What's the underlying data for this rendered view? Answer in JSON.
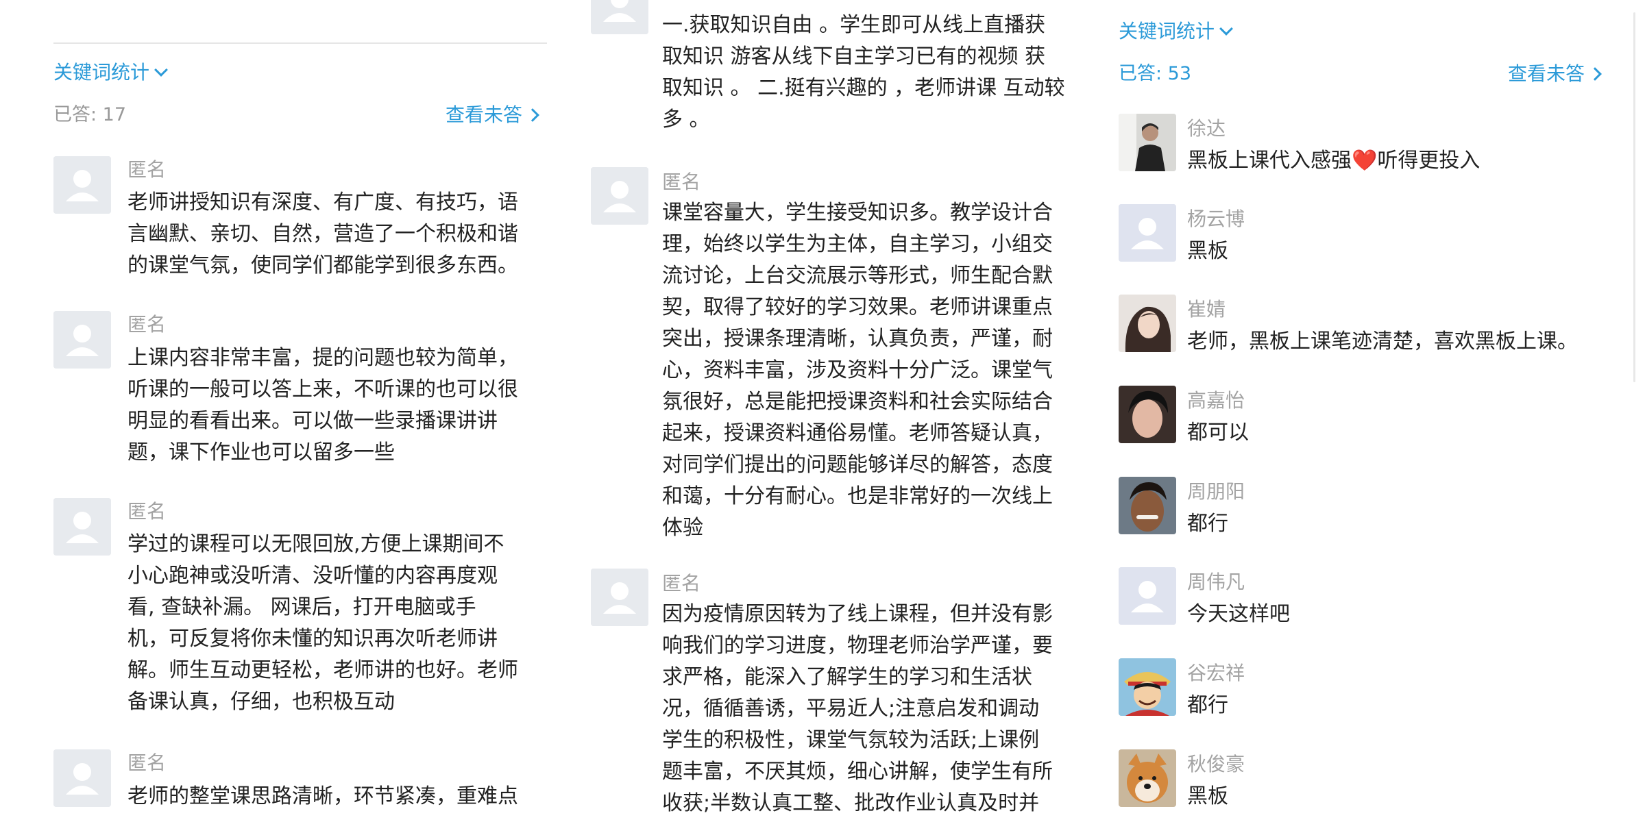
{
  "panels": {
    "left": {
      "keyword_toggle": "关键词统计",
      "answered": "已答: 17",
      "view_unanswered": "查看未答",
      "entries": [
        {
          "name": "匿名",
          "text": "老师讲授知识有深度、有广度、有技巧，语\n言幽默、亲切、自然，营造了一个积极和谐\n的课堂气氛，使同学们都能学到很多东西。"
        },
        {
          "name": "匿名",
          "text": "上课内容非常丰富，提的问题也较为简单，\n听课的一般可以答上来，不听课的也可以很\n明显的看看出来。可以做一些录播课讲讲\n题，课下作业也可以留多一些"
        },
        {
          "name": "匿名",
          "text": "学过的课程可以无限回放,方便上课期间不\n小心跑神或没听清、没听懂的内容再度观\n看, 查缺补漏。  网课后，打开电脑或手\n机，可反复将你未懂的知识再次听老师讲\n解。师生互动更轻松，老师讲的也好。老师\n备课认真，仔细，也积极互动"
        },
        {
          "name": "匿名",
          "text": "老师的整堂课思路清晰，环节紧凑，重难点"
        }
      ]
    },
    "middle": {
      "entries": [
        {
          "name": "",
          "text": "一.获取知识自由 。学生即可从线上直播获\n取知识 游客从线下自主学习已有的视频 获\n取知识 。 二.挺有兴趣的 ，老师讲课 互动较\n多 。"
        },
        {
          "name": "匿名",
          "text": "课堂容量大，学生接受知识多。教学设计合\n理，始终以学生为主体，自主学习，小组交\n流讨论，上台交流展示等形式，师生配合默\n契，取得了较好的学习效果。老师讲课重点\n突出，授课条理清晰，认真负责，严谨，耐\n心，资料丰富，涉及资料十分广泛。课堂气\n氛很好，总是能把授课资料和社会实际结合\n起来，授课资料通俗易懂。老师答疑认真，\n对同学们提出的问题能够详尽的解答，态度\n和蔼，十分有耐心。也是非常好的一次线上\n体验"
        },
        {
          "name": "匿名",
          "text": "因为疫情原因转为了线上课程，但并没有影\n响我们的学习进度，物理老师治学严谨，要\n求严格，能深入了解学生的学习和生活状\n况，循循善诱，平易近人;注意启发和调动\n学生的积极性，课堂气氛较为活跃;上课例\n题丰富，不厌其烦，细心讲解，使学生有所\n收获;半数认真工整、批改作业认真及时并"
        }
      ]
    },
    "right": {
      "keyword_toggle": "关键词统计",
      "answered": "已答: 53",
      "view_unanswered": "查看未答",
      "entries": [
        {
          "name": "徐达",
          "text": "黑板上课代入感强❤️听得更投入",
          "avatar": "photo-portrait"
        },
        {
          "name": "杨云博",
          "text": "黑板",
          "avatar": "default"
        },
        {
          "name": "崔婧",
          "text": "老师，黑板上课笔迹清楚，喜欢黑板上课。",
          "avatar": "photo-portrait"
        },
        {
          "name": "高嘉怡",
          "text": "都可以",
          "avatar": "photo-portrait"
        },
        {
          "name": "周朋阳",
          "text": "都行",
          "avatar": "photo-portrait"
        },
        {
          "name": "周伟凡",
          "text": "今天这样吧",
          "avatar": "default"
        },
        {
          "name": "谷宏祥",
          "text": "都行",
          "avatar": "cartoon"
        },
        {
          "name": "秋俊豪",
          "text": "黑板",
          "avatar": "dog-photo"
        }
      ]
    }
  },
  "colors": {
    "link": "#2b9ad8",
    "name": "#a3a3a3",
    "text": "#222222",
    "answered_left": "#999999",
    "answered_right": "#2b9ad8",
    "avatar_bg": "#e7eaee"
  }
}
